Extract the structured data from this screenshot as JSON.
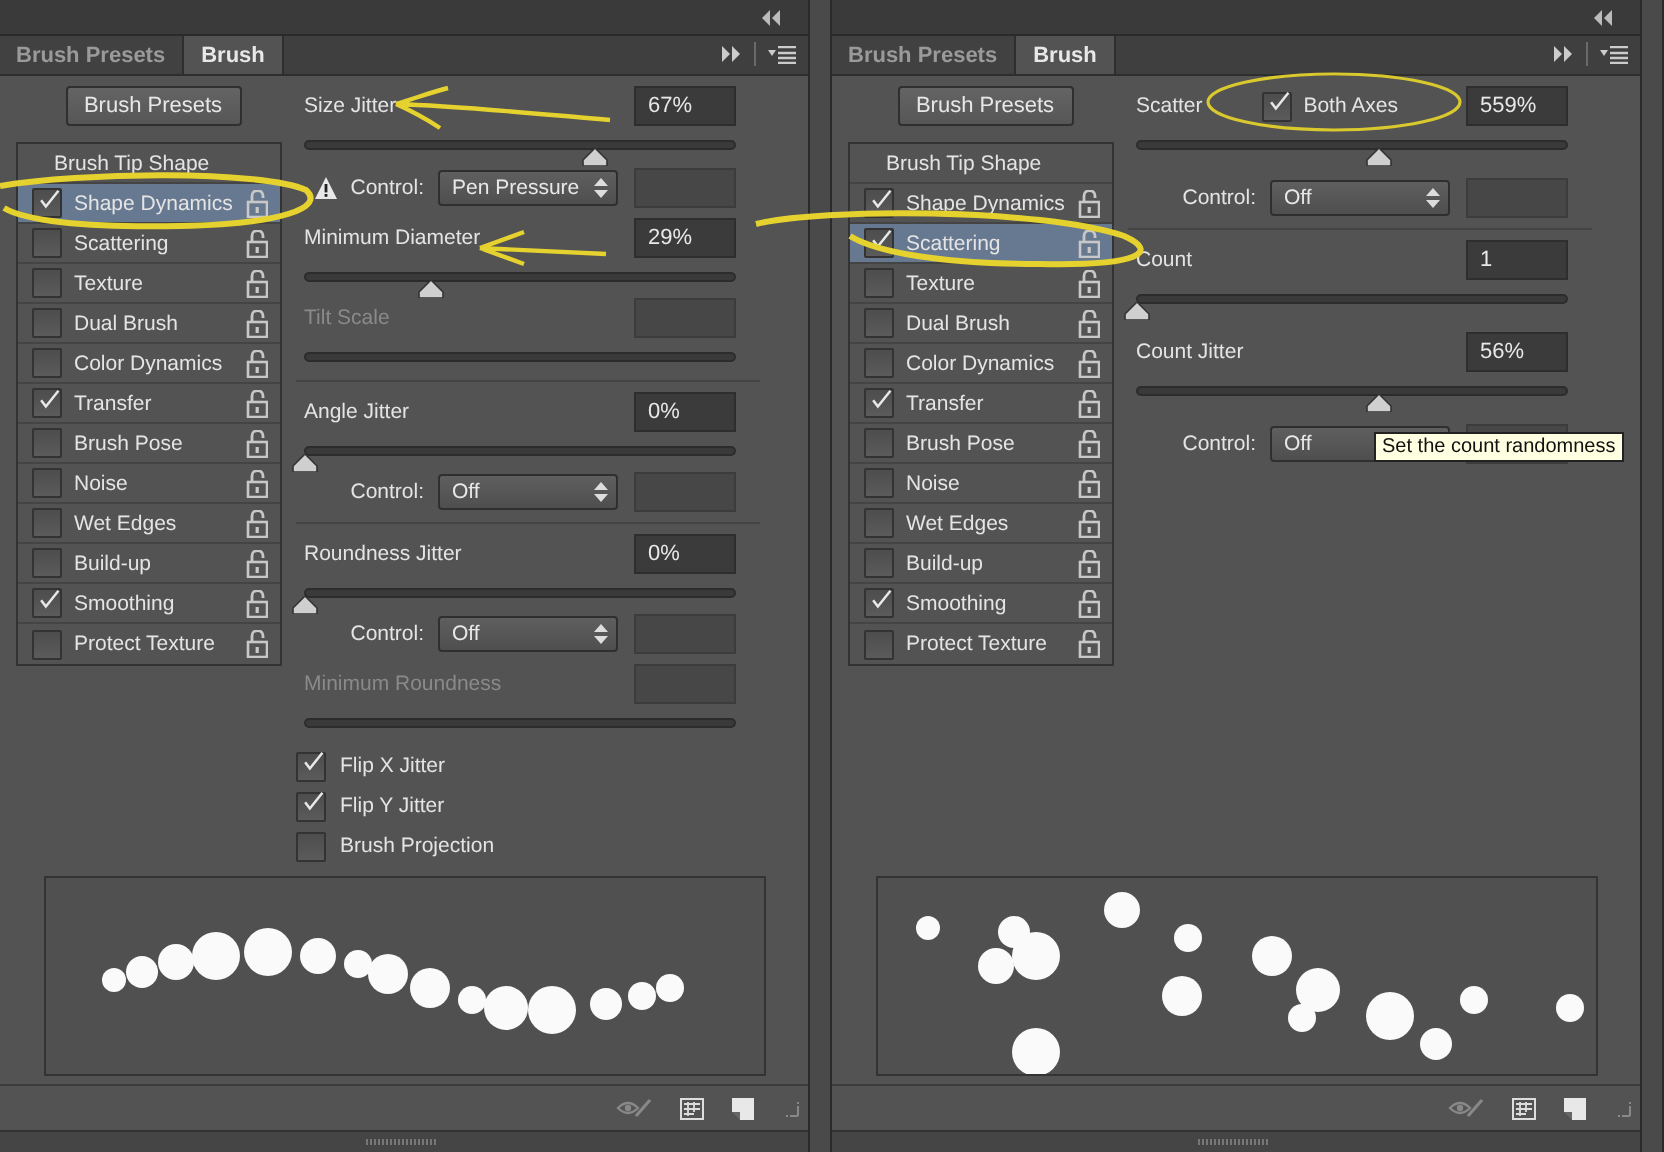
{
  "panels": [
    {
      "tabs": [
        {
          "label": "Brush Presets",
          "selected": false
        },
        {
          "label": "Brush",
          "selected": true
        }
      ],
      "presets_button": "Brush Presets",
      "list_header": "Brush Tip Shape",
      "options": [
        {
          "label": "Shape Dynamics",
          "checked": true,
          "selected": true
        },
        {
          "label": "Scattering",
          "checked": false,
          "selected": false
        },
        {
          "label": "Texture",
          "checked": false,
          "selected": false
        },
        {
          "label": "Dual Brush",
          "checked": false,
          "selected": false
        },
        {
          "label": "Color Dynamics",
          "checked": false,
          "selected": false
        },
        {
          "label": "Transfer",
          "checked": true,
          "selected": false
        },
        {
          "label": "Brush Pose",
          "checked": false,
          "selected": false
        },
        {
          "label": "Noise",
          "checked": false,
          "selected": false
        },
        {
          "label": "Wet Edges",
          "checked": false,
          "selected": false
        },
        {
          "label": "Build-up",
          "checked": false,
          "selected": false
        },
        {
          "label": "Smoothing",
          "checked": true,
          "selected": false
        },
        {
          "label": "Protect Texture",
          "checked": false,
          "selected": false
        }
      ],
      "settings": [
        {
          "kind": "slider",
          "label": "Size Jitter",
          "value": "67%",
          "level": 0.67,
          "disabled": false
        },
        {
          "kind": "control",
          "label": "Control:",
          "value": "Pen Pressure",
          "warning": true
        },
        {
          "kind": "slider",
          "label": "Minimum Diameter",
          "value": "29%",
          "level": 0.29,
          "disabled": false
        },
        {
          "kind": "slider",
          "label": "Tilt Scale",
          "disabled": true
        },
        {
          "kind": "divider"
        },
        {
          "kind": "slider",
          "label": "Angle Jitter",
          "value": "0%",
          "level": 0,
          "disabled": false
        },
        {
          "kind": "control",
          "label": "Control:",
          "value": "Off",
          "warning": false
        },
        {
          "kind": "divider"
        },
        {
          "kind": "slider",
          "label": "Roundness Jitter",
          "value": "0%",
          "level": 0,
          "disabled": false
        },
        {
          "kind": "control",
          "label": "Control:",
          "value": "Off",
          "warning": false
        },
        {
          "kind": "slider",
          "label": "Minimum Roundness",
          "disabled": true
        },
        {
          "kind": "checks",
          "items": [
            {
              "label": "Flip X Jitter",
              "checked": true
            },
            {
              "label": "Flip Y Jitter",
              "checked": true
            },
            {
              "label": "Brush Projection",
              "checked": false
            }
          ]
        }
      ],
      "preview": {
        "kind": "stroke"
      }
    },
    {
      "tabs": [
        {
          "label": "Brush Presets",
          "selected": false
        },
        {
          "label": "Brush",
          "selected": true
        }
      ],
      "presets_button": "Brush Presets",
      "list_header": "Brush Tip Shape",
      "options": [
        {
          "label": "Shape Dynamics",
          "checked": true,
          "selected": false
        },
        {
          "label": "Scattering",
          "checked": true,
          "selected": true
        },
        {
          "label": "Texture",
          "checked": false,
          "selected": false
        },
        {
          "label": "Dual Brush",
          "checked": false,
          "selected": false
        },
        {
          "label": "Color Dynamics",
          "checked": false,
          "selected": false
        },
        {
          "label": "Transfer",
          "checked": true,
          "selected": false
        },
        {
          "label": "Brush Pose",
          "checked": false,
          "selected": false
        },
        {
          "label": "Noise",
          "checked": false,
          "selected": false
        },
        {
          "label": "Wet Edges",
          "checked": false,
          "selected": false
        },
        {
          "label": "Build-up",
          "checked": false,
          "selected": false
        },
        {
          "label": "Smoothing",
          "checked": true,
          "selected": false
        },
        {
          "label": "Protect Texture",
          "checked": false,
          "selected": false
        }
      ],
      "settings": [
        {
          "kind": "slider",
          "label": "Scatter",
          "value": "559%",
          "level": 0.56,
          "disabled": false,
          "axis_check": {
            "label": "Both Axes",
            "checked": true
          }
        },
        {
          "kind": "control",
          "label": "Control:",
          "value": "Off",
          "warning": false
        },
        {
          "kind": "divider"
        },
        {
          "kind": "slider",
          "label": "Count",
          "value": "1",
          "level": 0,
          "disabled": false
        },
        {
          "kind": "slider",
          "label": "Count Jitter",
          "value": "56%",
          "level": 0.56,
          "disabled": false
        },
        {
          "kind": "control",
          "label": "Control:",
          "value": "Off",
          "warning": false,
          "tooltip": "Set the count randomness"
        }
      ],
      "preview": {
        "kind": "scatter"
      }
    }
  ]
}
